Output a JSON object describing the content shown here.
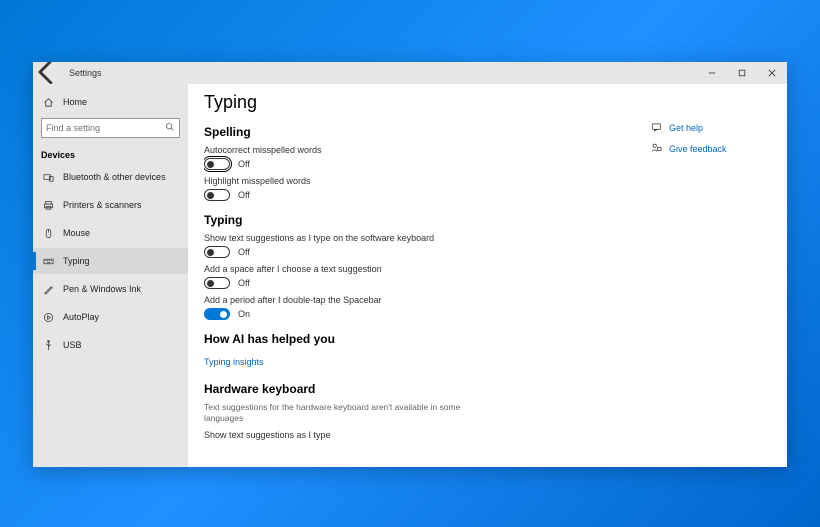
{
  "titlebar": {
    "title": "Settings"
  },
  "sidebar": {
    "home": "Home",
    "search_placeholder": "Find a setting",
    "heading": "Devices",
    "items": [
      {
        "label": "Bluetooth & other devices"
      },
      {
        "label": "Printers & scanners"
      },
      {
        "label": "Mouse"
      },
      {
        "label": "Typing"
      },
      {
        "label": "Pen & Windows Ink"
      },
      {
        "label": "AutoPlay"
      },
      {
        "label": "USB"
      }
    ]
  },
  "page": {
    "title": "Typing",
    "sections": {
      "spelling": {
        "heading": "Spelling",
        "autocorrect_label": "Autocorrect misspelled words",
        "autocorrect_state": "Off",
        "highlight_label": "Highlight misspelled words",
        "highlight_state": "Off"
      },
      "typing": {
        "heading": "Typing",
        "suggestions_label": "Show text suggestions as I type on the software keyboard",
        "suggestions_state": "Off",
        "space_label": "Add a space after I choose a text suggestion",
        "space_state": "Off",
        "period_label": "Add a period after I double-tap the Spacebar",
        "period_state": "On"
      },
      "ai": {
        "heading": "How AI has helped you",
        "link": "Typing insights"
      },
      "hardware": {
        "heading": "Hardware keyboard",
        "desc": "Text suggestions for the hardware keyboard aren't available in some languages",
        "suggestions_label": "Show text suggestions as I type"
      }
    }
  },
  "right": {
    "help": "Get help",
    "feedback": "Give feedback"
  }
}
